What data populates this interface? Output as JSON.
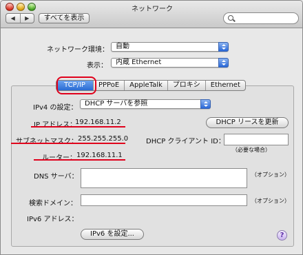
{
  "window": {
    "title": "ネットワーク"
  },
  "toolbar": {
    "back_glyph": "◀",
    "forward_glyph": "▶",
    "show_all_label": "すべてを表示",
    "search_placeholder": ""
  },
  "location": {
    "label": "ネットワーク環境：",
    "value": "自動"
  },
  "show": {
    "label": "表示：",
    "value": "内蔵 Ethernet"
  },
  "tabs": [
    {
      "label": "TCP/IP"
    },
    {
      "label": "PPPoE"
    },
    {
      "label": "AppleTalk"
    },
    {
      "label": "プロキシ"
    },
    {
      "label": "Ethernet"
    }
  ],
  "ipv4": {
    "label": "IPv4 の設定：",
    "value": "DHCP サーバを参照"
  },
  "ip_address": {
    "label": "IP アドレス：",
    "value": "192.168.11.2"
  },
  "renew_button": "DHCP リースを更新",
  "subnet": {
    "label": "サブネットマスク：",
    "value": "255.255.255.0"
  },
  "dhcp_client": {
    "label": "DHCP クライアント ID：",
    "hint": "（必要な場合）",
    "value": ""
  },
  "router": {
    "label": "ルーター：",
    "value": "192.168.11.1"
  },
  "dns": {
    "label": "DNS サーバ：",
    "hint": "（オプション）",
    "value": ""
  },
  "search_domain": {
    "label": "検索ドメイン：",
    "hint": "（オプション）",
    "value": ""
  },
  "ipv6": {
    "label": "IPv6 アドレス：",
    "button": "IPv6 を設定..."
  },
  "help_glyph": "?",
  "colors": {
    "accent": "#2a6bd3",
    "annotation_red": "#e0001b"
  }
}
